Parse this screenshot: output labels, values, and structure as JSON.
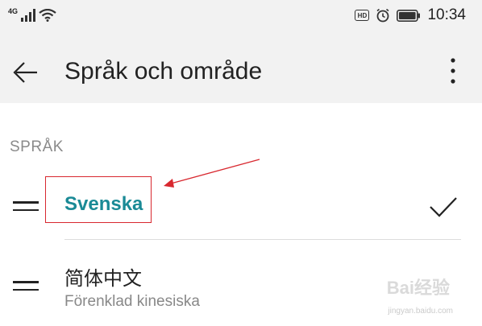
{
  "status_bar": {
    "network": "4G",
    "hd_badge": "HD",
    "time": "10:34",
    "icons": [
      "signal-icon",
      "wifi-icon",
      "hd-icon",
      "alarm-icon",
      "battery-icon"
    ]
  },
  "header": {
    "title": "Språk och område",
    "back_icon": "back-arrow-icon",
    "menu_icon": "more-vertical-icon"
  },
  "section": {
    "label": "SPRÅK"
  },
  "languages": [
    {
      "name": "Svenska",
      "subtitle": "",
      "selected": true
    },
    {
      "name": "简体中文",
      "subtitle": "Förenklad kinesiska",
      "selected": false
    }
  ],
  "colors": {
    "accent": "#1a8a96",
    "annotation": "#d8282f",
    "topbar_bg": "#f2f2f2"
  },
  "watermark": {
    "main": "Bai经验",
    "sub": "jingyan.baidu.com"
  }
}
